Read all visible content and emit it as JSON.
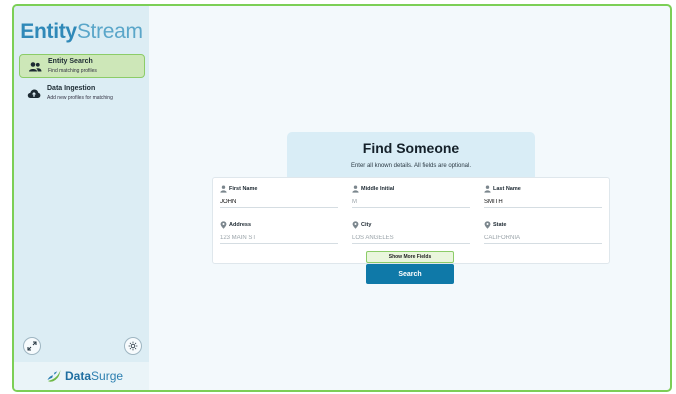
{
  "app": {
    "logo_bold": "Entity",
    "logo_light": "Stream"
  },
  "sidebar": {
    "items": [
      {
        "title": "Entity Search",
        "subtitle": "Find matching profiles",
        "icon": "people-icon",
        "active": true
      },
      {
        "title": "Data Ingestion",
        "subtitle": "Add new profiles for matching",
        "icon": "cloud-upload-icon",
        "active": false
      }
    ],
    "brand_bold": "Data",
    "brand_light": "Surge"
  },
  "search": {
    "title": "Find Someone",
    "subtitle": "Enter all known details. All fields are optional.",
    "fields": [
      {
        "label": "First Name",
        "value": "JOHN",
        "placeholder": "",
        "icon": "person-icon"
      },
      {
        "label": "Middle Initial",
        "value": "",
        "placeholder": "M",
        "icon": "person-icon"
      },
      {
        "label": "Last Name",
        "value": "SMITH",
        "placeholder": "",
        "icon": "person-icon"
      },
      {
        "label": "Address",
        "value": "",
        "placeholder": "123 MAIN ST",
        "icon": "location-pin-icon"
      },
      {
        "label": "City",
        "value": "",
        "placeholder": "LOS ANGELES",
        "icon": "location-pin-icon"
      },
      {
        "label": "State",
        "value": "",
        "placeholder": "CALIFORNIA",
        "icon": "location-pin-icon"
      }
    ],
    "more_fields_label": "Show More Fields",
    "search_label": "Search"
  },
  "colors": {
    "accent_green": "#8ccc68",
    "primary_blue": "#0f79a8",
    "sidebar_bg": "#dcedf4"
  }
}
